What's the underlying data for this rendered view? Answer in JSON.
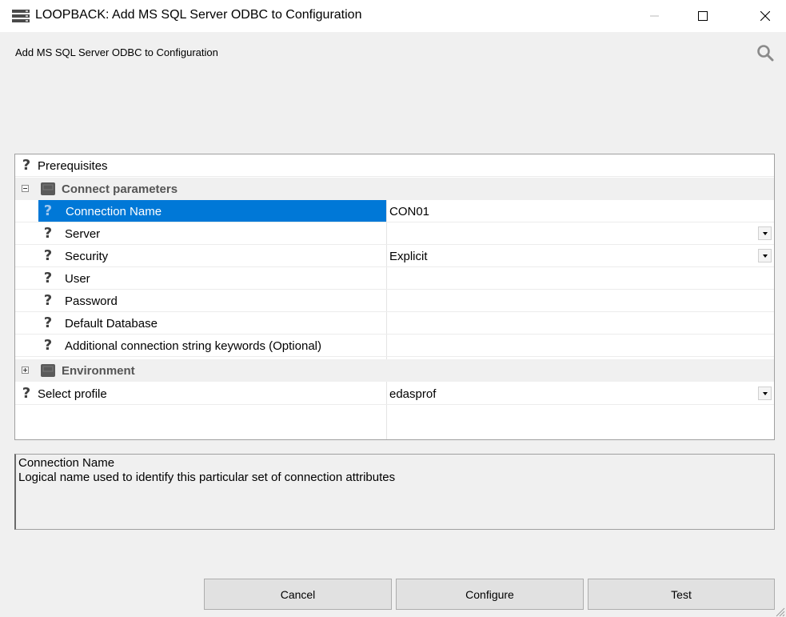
{
  "window": {
    "title": "LOOPBACK: Add MS SQL Server ODBC  to Configuration",
    "icon": "server-app-icon",
    "controls": [
      "minimize-icon",
      "maximize-icon",
      "close-icon"
    ]
  },
  "header": {
    "subtitle": "Add MS SQL Server ODBC  to Configuration",
    "search_icon": "search-icon"
  },
  "grid": {
    "prerequisites_label": "Prerequisites",
    "connect_parameters": {
      "label": "Connect parameters",
      "expanded": true,
      "properties": [
        {
          "name": "Connection Name",
          "value": "CON01",
          "selected": true,
          "dropdown": false
        },
        {
          "name": "Server",
          "value": "",
          "dropdown": true
        },
        {
          "name": "Security",
          "value": "Explicit",
          "dropdown": true
        },
        {
          "name": "User",
          "value": "",
          "dropdown": false
        },
        {
          "name": "Password",
          "value": "",
          "dropdown": false
        },
        {
          "name": "Default Database",
          "value": "",
          "dropdown": false
        },
        {
          "name": "Additional connection string keywords (Optional)",
          "value": "",
          "dropdown": false
        }
      ]
    },
    "environment": {
      "label": "Environment",
      "expanded": false
    },
    "select_profile": {
      "name": "Select profile",
      "value": "edasprof",
      "dropdown": true
    }
  },
  "description": {
    "title": "Connection Name",
    "body": "Logical name used to identify this particular set of connection attributes"
  },
  "buttons": {
    "cancel": "Cancel",
    "configure": "Configure",
    "test": "Test"
  },
  "colors": {
    "selection": "#0078d7",
    "window_background": "#f0f0f0",
    "category_background": "#f0f0f0"
  }
}
